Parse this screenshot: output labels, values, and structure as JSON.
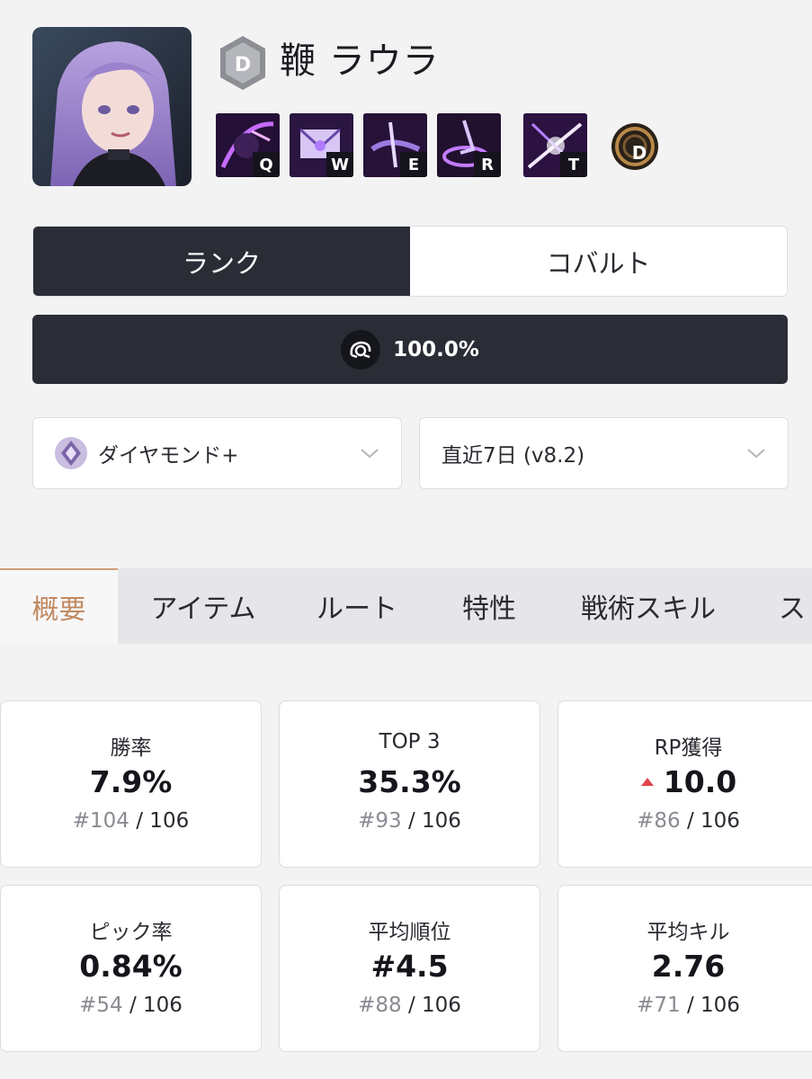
{
  "character": {
    "tier_letter": "D",
    "name": "鞭 ラウラ",
    "skills": [
      {
        "key": "Q",
        "icon": "skill-q-icon"
      },
      {
        "key": "W",
        "icon": "skill-w-icon"
      },
      {
        "key": "E",
        "icon": "skill-e-icon"
      },
      {
        "key": "R",
        "icon": "skill-r-icon"
      },
      {
        "key": "T",
        "icon": "passive-t-icon"
      }
    ],
    "weapon_letter": "D"
  },
  "mode_toggle": {
    "options": [
      "ランク",
      "コバルト"
    ],
    "active": "ランク"
  },
  "filter_bar": {
    "icon": "server-filter-icon",
    "percent": "100.0%"
  },
  "dropdowns": {
    "rank": {
      "icon": "diamond-rank-icon",
      "value": "ダイヤモンド+"
    },
    "period": {
      "value": "直近7日 (v8.2)"
    }
  },
  "tabs": {
    "items": [
      "概要",
      "アイテム",
      "ルート",
      "特性",
      "戦術スキル",
      "ス"
    ],
    "active": "概要"
  },
  "stats": [
    {
      "label": "勝率",
      "value": "7.9%",
      "rank_pos": "#104",
      "rank_total": "/ 106"
    },
    {
      "label": "TOP 3",
      "value": "35.3%",
      "rank_pos": "#93",
      "rank_total": "/ 106"
    },
    {
      "label": "RP獲得",
      "value": "10.0",
      "trend": "up",
      "rank_pos": "#86",
      "rank_total": "/ 106"
    },
    {
      "label": "ピック率",
      "value": "0.84%",
      "rank_pos": "#54",
      "rank_total": "/ 106"
    },
    {
      "label": "平均順位",
      "value": "#4.5",
      "rank_pos": "#88",
      "rank_total": "/ 106"
    },
    {
      "label": "平均キル",
      "value": "2.76",
      "rank_pos": "#71",
      "rank_total": "/ 106"
    }
  ],
  "colors": {
    "dark": "#2b2d36",
    "accent_tab": "#c28a62",
    "trend_up": "#e0474c",
    "skill_purple": "#7c3aed"
  }
}
